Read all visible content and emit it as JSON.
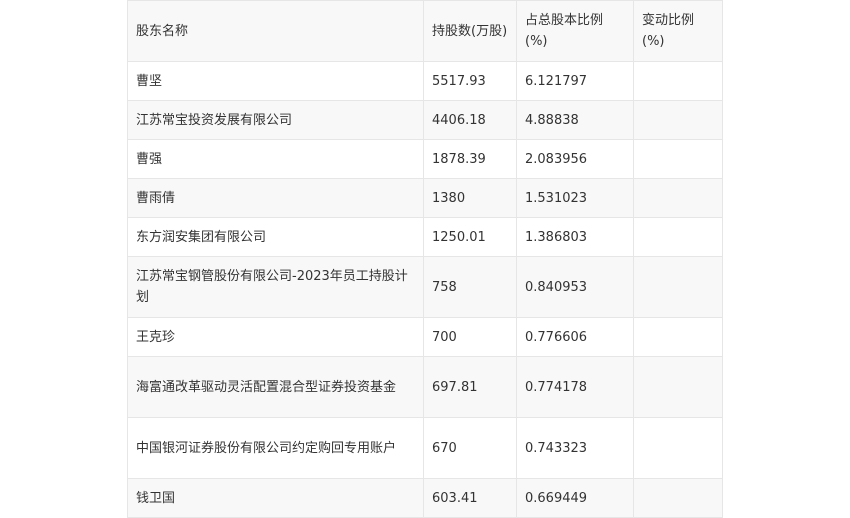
{
  "table": {
    "headers": [
      "股东名称",
      "持股数(万股)",
      "占总股本比例(%)",
      "变动比例(%)"
    ],
    "rows": [
      [
        "曹坚",
        "5517.93",
        "6.121797",
        ""
      ],
      [
        "江苏常宝投资发展有限公司",
        "4406.18",
        "4.88838",
        ""
      ],
      [
        "曹强",
        "1878.39",
        "2.083956",
        ""
      ],
      [
        "曹雨倩",
        "1380",
        "1.531023",
        ""
      ],
      [
        "东方润安集团有限公司",
        "1250.01",
        "1.386803",
        ""
      ],
      [
        "江苏常宝钢管股份有限公司-2023年员工持股计划",
        "758",
        "0.840953",
        ""
      ],
      [
        "王克珍",
        "700",
        "0.776606",
        ""
      ],
      [
        "海富通改革驱动灵活配置混合型证券投资基金",
        "697.81",
        "0.774178",
        ""
      ],
      [
        "中国银河证券股份有限公司约定购回专用账户",
        "670",
        "0.743323",
        ""
      ],
      [
        "钱卫国",
        "603.41",
        "0.669449",
        ""
      ]
    ]
  }
}
